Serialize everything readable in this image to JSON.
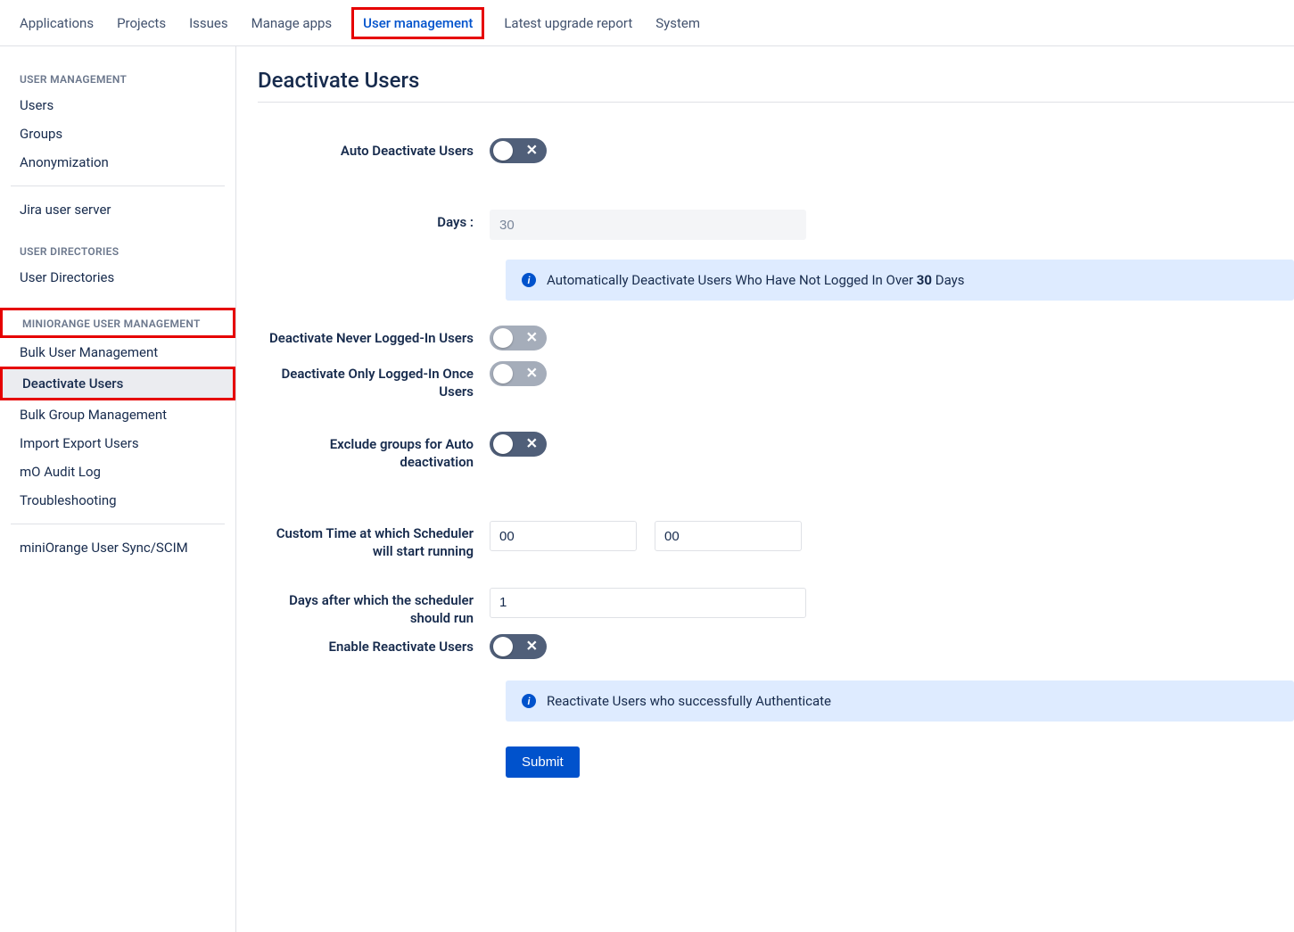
{
  "topnav": {
    "items": [
      {
        "label": "Applications"
      },
      {
        "label": "Projects"
      },
      {
        "label": "Issues"
      },
      {
        "label": "Manage apps"
      },
      {
        "label": "User management",
        "active": true,
        "highlighted": true
      },
      {
        "label": "Latest upgrade report"
      },
      {
        "label": "System"
      }
    ]
  },
  "sidebar": {
    "sections": [
      {
        "title": "USER MANAGEMENT",
        "items": [
          {
            "label": "Users"
          },
          {
            "label": "Groups"
          },
          {
            "label": "Anonymization"
          }
        ]
      },
      {
        "items": [
          {
            "label": "Jira user server"
          }
        ]
      },
      {
        "title": "USER DIRECTORIES",
        "items": [
          {
            "label": "User Directories"
          }
        ]
      },
      {
        "title": "MINIORANGE USER MANAGEMENT",
        "title_highlighted": true,
        "items": [
          {
            "label": "Bulk User Management"
          },
          {
            "label": "Deactivate Users",
            "active": true,
            "highlighted": true
          },
          {
            "label": "Bulk Group Management"
          },
          {
            "label": "Import Export Users"
          },
          {
            "label": "mO Audit Log"
          },
          {
            "label": "Troubleshooting"
          }
        ]
      },
      {
        "items": [
          {
            "label": "miniOrange User Sync/SCIM"
          }
        ]
      }
    ]
  },
  "page": {
    "title": "Deactivate Users",
    "fields": {
      "auto_deactivate_label": "Auto Deactivate Users",
      "auto_deactivate_on": true,
      "days_label": "Days :",
      "days_value": "30",
      "info1_prefix": "Automatically Deactivate Users Who Have Not Logged In Over ",
      "info1_bold": "30",
      "info1_suffix": " Days",
      "never_logged_label": "Deactivate Never Logged-In Users",
      "never_logged_on": false,
      "once_logged_label": "Deactivate Only Logged-In Once Users",
      "once_logged_on": false,
      "exclude_groups_label": "Exclude groups for Auto deactivation",
      "exclude_groups_on": true,
      "scheduler_time_label": "Custom Time at which Scheduler will start running",
      "scheduler_hour": "00",
      "scheduler_min": "00",
      "scheduler_days_label": "Days after which the scheduler should run",
      "scheduler_days_value": "1",
      "reactivate_label": "Enable Reactivate Users",
      "reactivate_on": true,
      "info2_text": "Reactivate Users who successfully Authenticate",
      "submit_label": "Submit"
    }
  }
}
